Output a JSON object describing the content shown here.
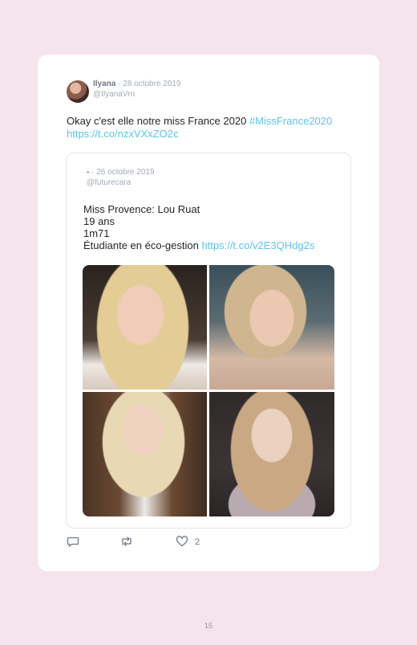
{
  "tweet": {
    "display_name": "Ilyana",
    "separator": " · ",
    "date": "28 octobre 2019",
    "handle": "@IlyanaVrn",
    "text": "Okay c'est elle notre miss France 2020 ",
    "hashtag": "#MissFrance2020",
    "link": "https://t.co/nzxVXxZO2c"
  },
  "quoted_tweet": {
    "display_name": "-",
    "separator": " · ",
    "date": "26 octobre 2019",
    "handle": "@futurecara",
    "lines": [
      "Miss Provence: Lou Ruat",
      "19 ans",
      "1m71",
      "Étudiante en éco-gestion "
    ],
    "link": "https://t.co/v2E3QHdg2s",
    "photos": [
      "photo-1",
      "photo-2",
      "photo-3",
      "photo-4"
    ]
  },
  "actions": {
    "icons": [
      "reply-icon",
      "retweet-icon",
      "like-icon"
    ],
    "like_count": "2"
  },
  "page_number": "15"
}
